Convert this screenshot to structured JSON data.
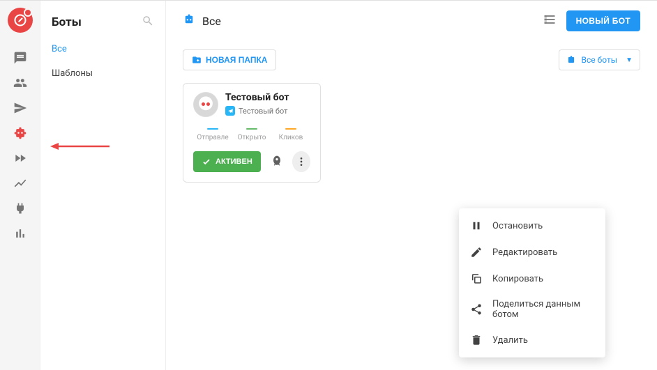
{
  "sidebar": {
    "title": "Боты",
    "items": [
      {
        "label": "Все",
        "active": true
      },
      {
        "label": "Шаблоны",
        "active": false
      }
    ]
  },
  "topbar": {
    "title": "Все",
    "new_bot": "НОВЫЙ БОТ"
  },
  "toolbar": {
    "new_folder": "НОВАЯ ПАПКА",
    "filter": "Все боты"
  },
  "card": {
    "title": "Тестовый бот",
    "subtitle": "Тестовый бот",
    "stats": [
      {
        "label": "Отправле"
      },
      {
        "label": "Открыто"
      },
      {
        "label": "Кликов"
      }
    ],
    "active_btn": "АКТИВЕН"
  },
  "menu": {
    "items": [
      {
        "label": "Остановить",
        "icon": "pause"
      },
      {
        "label": "Редактировать",
        "icon": "edit"
      },
      {
        "label": "Копировать",
        "icon": "copy"
      },
      {
        "label": "Поделиться данным ботом",
        "icon": "share"
      },
      {
        "label": "Удалить",
        "icon": "trash"
      }
    ]
  }
}
